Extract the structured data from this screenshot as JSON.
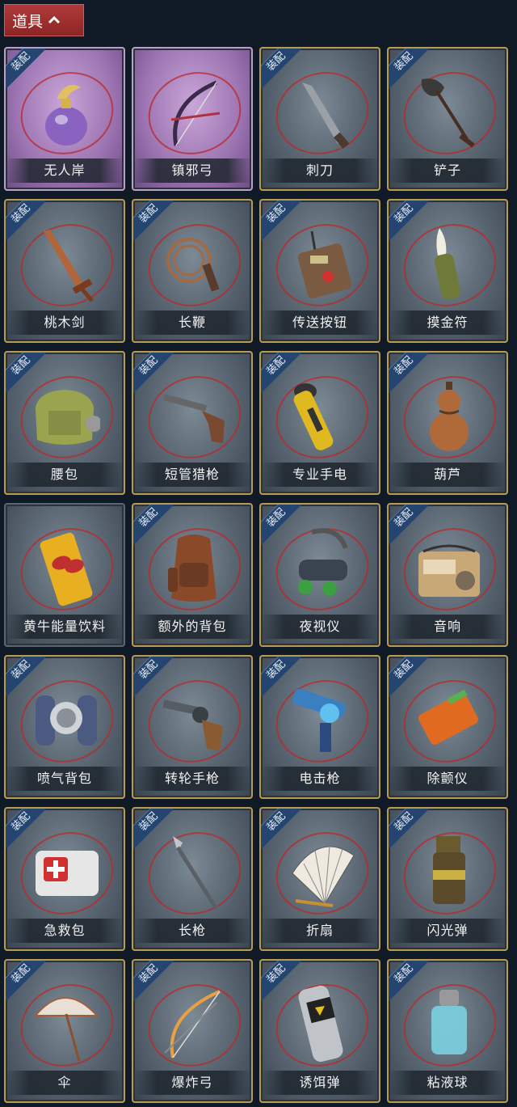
{
  "header": {
    "title": "道具"
  },
  "equip_label": "装配",
  "items": [
    {
      "name": "无人岸",
      "icon": "potion-bottle-icon",
      "style": "purple",
      "equip": true,
      "color": "#8a63c0"
    },
    {
      "name": "镇邪弓",
      "icon": "bow-icon",
      "style": "purple",
      "equip": false,
      "color": "#3a2a4a"
    },
    {
      "name": "刺刀",
      "icon": "bayonet-icon",
      "style": "grey",
      "equip": true,
      "color": "#9aa0a6"
    },
    {
      "name": "铲子",
      "icon": "shovel-icon",
      "style": "grey",
      "equip": true,
      "color": "#4a2e22"
    },
    {
      "name": "桃木剑",
      "icon": "wooden-sword-icon",
      "style": "grey",
      "equip": true,
      "color": "#b0653a"
    },
    {
      "name": "长鞭",
      "icon": "whip-icon",
      "style": "grey",
      "equip": true,
      "color": "#a06a45"
    },
    {
      "name": "传送按钮",
      "icon": "remote-button-icon",
      "style": "grey",
      "equip": true,
      "color": "#7a5a40"
    },
    {
      "name": "摸金符",
      "icon": "claw-amulet-icon",
      "style": "grey",
      "equip": true,
      "color": "#6f7a3a"
    },
    {
      "name": "腰包",
      "icon": "waist-bag-icon",
      "style": "grey",
      "equip": true,
      "color": "#9aa44e"
    },
    {
      "name": "短管猎枪",
      "icon": "shotgun-icon",
      "style": "grey",
      "equip": true,
      "color": "#7a4a30"
    },
    {
      "name": "专业手电",
      "icon": "flashlight-icon",
      "style": "grey",
      "equip": true,
      "color": "#e0b820"
    },
    {
      "name": "葫芦",
      "icon": "gourd-icon",
      "style": "grey",
      "equip": true,
      "color": "#b06a3a"
    },
    {
      "name": "黄牛能量饮料",
      "icon": "energy-drink-icon",
      "style": "plain",
      "equip": false,
      "color": "#e8b020"
    },
    {
      "name": "额外的背包",
      "icon": "backpack-icon",
      "style": "grey",
      "equip": true,
      "color": "#8a4a2a"
    },
    {
      "name": "夜视仪",
      "icon": "night-vision-goggles-icon",
      "style": "grey",
      "equip": true,
      "color": "#3aa040"
    },
    {
      "name": "音响",
      "icon": "radio-icon",
      "style": "grey",
      "equip": true,
      "color": "#c9a878"
    },
    {
      "name": "喷气背包",
      "icon": "jetpack-icon",
      "style": "grey",
      "equip": true,
      "color": "#4a5a80"
    },
    {
      "name": "转轮手枪",
      "icon": "revolver-icon",
      "style": "grey",
      "equip": true,
      "color": "#555c64"
    },
    {
      "name": "电击枪",
      "icon": "shock-gun-icon",
      "style": "grey",
      "equip": true,
      "color": "#3a80c0"
    },
    {
      "name": "除颤仪",
      "icon": "defibrillator-icon",
      "style": "grey",
      "equip": true,
      "color": "#e06a20"
    },
    {
      "name": "急救包",
      "icon": "first-aid-kit-icon",
      "style": "grey",
      "equip": true,
      "color": "#e6e6e6"
    },
    {
      "name": "长枪",
      "icon": "spear-icon",
      "style": "grey",
      "equip": true,
      "color": "#5a5f66"
    },
    {
      "name": "折扇",
      "icon": "folding-fan-icon",
      "style": "grey",
      "equip": true,
      "color": "#efeae0"
    },
    {
      "name": "闪光弹",
      "icon": "flash-grenade-icon",
      "style": "grey",
      "equip": true,
      "color": "#c9b040"
    },
    {
      "name": "伞",
      "icon": "umbrella-icon",
      "style": "grey",
      "equip": true,
      "color": "#e8e0d4"
    },
    {
      "name": "爆炸弓",
      "icon": "explosive-bow-icon",
      "style": "grey",
      "equip": true,
      "color": "#e8a040"
    },
    {
      "name": "诱饵弹",
      "icon": "decoy-grenade-icon",
      "style": "grey",
      "equip": true,
      "color": "#c0c4c8"
    },
    {
      "name": "粘液球",
      "icon": "slime-jar-icon",
      "style": "grey",
      "equip": true,
      "color": "#7ad0e0"
    }
  ]
}
